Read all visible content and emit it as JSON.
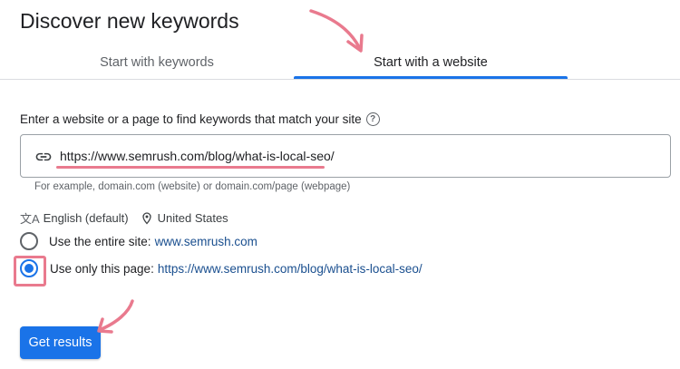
{
  "page": {
    "title": "Discover new keywords"
  },
  "tabs": [
    {
      "label": "Start with keywords",
      "active": false
    },
    {
      "label": "Start with a website",
      "active": true
    }
  ],
  "form": {
    "prompt": "Enter a website or a page to find keywords that match your site",
    "help_icon": "?",
    "url_value": "https://www.semrush.com/blog/what-is-local-seo/",
    "hint": "For example, domain.com (website) or domain.com/page (webpage)"
  },
  "locale": {
    "language": "English (default)",
    "location": "United States"
  },
  "scope_options": [
    {
      "label": "Use the entire site:",
      "value": "www.semrush.com",
      "selected": false
    },
    {
      "label": "Use only this page:",
      "value": "https://www.semrush.com/blog/what-is-local-seo/",
      "selected": true
    }
  ],
  "actions": {
    "get_results": "Get results"
  },
  "colors": {
    "accent": "#1a73e8",
    "annotation": "#e97a8e",
    "link": "#1a4f8f"
  },
  "icons": {
    "link": "link-icon",
    "help": "help-circle-icon",
    "translate": "translate-icon",
    "location": "location-pin-icon"
  }
}
